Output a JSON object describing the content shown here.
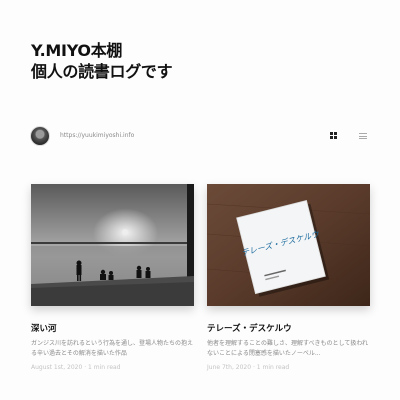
{
  "site": {
    "title_line1": "Y.MIYO本棚",
    "title_line2": "個人の読書ログです"
  },
  "author": {
    "url": "https://yuukimiyoshi.info"
  },
  "view_toggle": {
    "active": "grid",
    "icons": [
      "grid-view-icon",
      "list-view-icon"
    ]
  },
  "posts": [
    {
      "title": "深い河",
      "excerpt": "ガンジス川を訪れるという行為を通し、登場人物たちの抱える辛い過去とその解消を描いた作品",
      "date": "August 1st, 2020",
      "read_time": "1 min read",
      "image": "river-ganges-photo"
    },
    {
      "title": "テレーズ・デスケルウ",
      "excerpt": "他者を理解することの難しさ、理解すべきものとして扱われないことによる閉塞感を描いたノーベル...",
      "date": "June 7th, 2020",
      "read_time": "1 min read",
      "image": "book-cover-photo",
      "book_cover_text": "テレーズ・デスケルウ"
    }
  ],
  "meta_separator": " · "
}
